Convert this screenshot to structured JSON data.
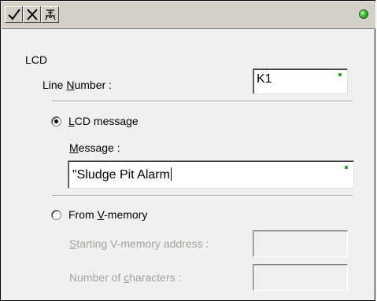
{
  "toolbar": {
    "buttons": [
      {
        "name": "check-icon"
      },
      {
        "name": "x-icon"
      },
      {
        "name": "help-icon"
      }
    ],
    "status_color": "#39c239"
  },
  "group_label": "LCD",
  "line_number": {
    "label_pre": "Line ",
    "label_mnemonic": "N",
    "label_post": "umber :",
    "value": "K1"
  },
  "option_lcd": {
    "label_mnemonic": "L",
    "label_post": "CD message",
    "selected": true
  },
  "message": {
    "label_mnemonic": "M",
    "label_post": "essage :",
    "value": "\"Sludge Pit Alarm"
  },
  "option_vmem": {
    "label_pre": "From ",
    "label_mnemonic": "V",
    "label_post": "-memory",
    "selected": false
  },
  "start_addr": {
    "label_mnemonic": "S",
    "label_post": "tarting V-memory address :",
    "value": ""
  },
  "num_chars": {
    "label_pre": "Number of ",
    "label_mnemonic": "c",
    "label_post": "haracters :",
    "value": ""
  }
}
